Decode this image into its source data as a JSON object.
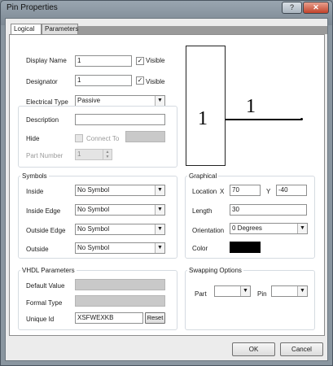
{
  "window": {
    "title": "Pin Properties",
    "help_btn": "?",
    "close_btn": "✕"
  },
  "tabs": [
    {
      "label": "Logical"
    },
    {
      "label": "Parameters"
    }
  ],
  "logical": {
    "display_name_label": "Display Name",
    "display_name_value": "1",
    "display_name_visible_label": "Visible",
    "designator_label": "Designator",
    "designator_value": "1",
    "designator_visible_label": "Visible",
    "electrical_type_label": "Electrical Type",
    "electrical_type_value": "Passive",
    "description_label": "Description",
    "description_value": "",
    "hide_label": "Hide",
    "connect_to_label": "Connect To",
    "part_number_label": "Part Number",
    "part_number_value": "1"
  },
  "preview": {
    "body_label": "1",
    "pin_label": "1"
  },
  "symbols": {
    "title": "Symbols",
    "rows": [
      {
        "label": "Inside",
        "value": "No Symbol"
      },
      {
        "label": "Inside Edge",
        "value": "No Symbol"
      },
      {
        "label": "Outside Edge",
        "value": "No Symbol"
      },
      {
        "label": "Outside",
        "value": "No Symbol"
      }
    ]
  },
  "graphical": {
    "title": "Graphical",
    "location_label": "Location",
    "x_label": "X",
    "x_value": "70",
    "y_label": "Y",
    "y_value": "-40",
    "length_label": "Length",
    "length_value": "30",
    "orientation_label": "Orientation",
    "orientation_value": "0 Degrees",
    "color_label": "Color",
    "color_value": "#000000"
  },
  "vhdl": {
    "title": "VHDL Parameters",
    "default_value_label": "Default Value",
    "formal_type_label": "Formal Type",
    "unique_id_label": "Unique Id",
    "unique_id_value": "XSFWEXKB",
    "reset_label": "Reset"
  },
  "swapping": {
    "title": "Swapping Options",
    "part_label": "Part",
    "part_value": "",
    "pin_label": "Pin",
    "pin_value": ""
  },
  "footer": {
    "ok_label": "OK",
    "cancel_label": "Cancel"
  }
}
